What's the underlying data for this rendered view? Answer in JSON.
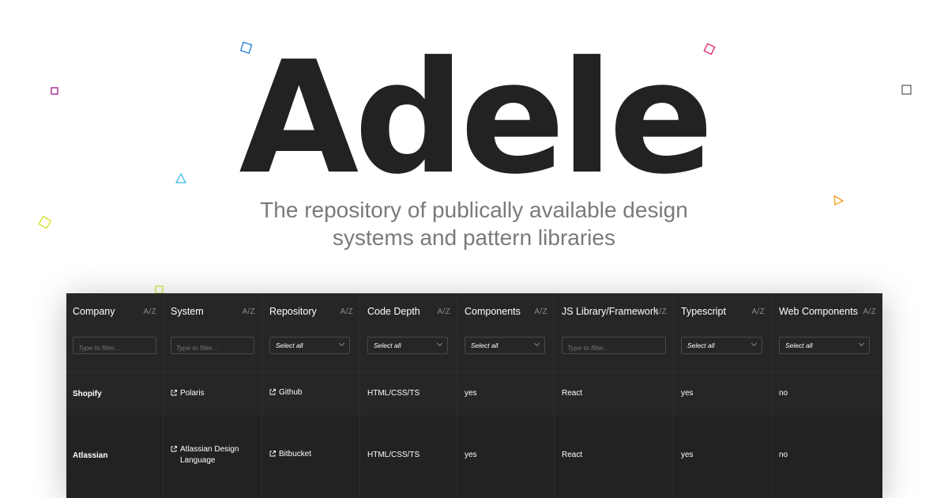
{
  "hero": {
    "title": "Adele",
    "subtitle": "The repository of publically available design systems and pattern libraries"
  },
  "colors": {
    "title": "#222222",
    "subtitle": "#7a7a7a",
    "table_bg": "#262626",
    "row_alt_bg": "#222222",
    "confetti_blue": "#1f7ad6",
    "confetti_pink": "#e0206e",
    "confetti_purple": "#a01a8c",
    "confetti_gray": "#555555",
    "confetti_cyan": "#2bb6e0",
    "confetti_yellow": "#d6e02b",
    "confetti_orange": "#f0a020"
  },
  "table": {
    "sort_label": "A/Z",
    "filter_placeholder": "Type to filter...",
    "select_placeholder": "Select all",
    "columns": [
      {
        "label": "Company",
        "filter": "input"
      },
      {
        "label": "System",
        "filter": "input"
      },
      {
        "label": "Repository",
        "filter": "select"
      },
      {
        "label": "Code Depth",
        "filter": "select"
      },
      {
        "label": "Components",
        "filter": "select"
      },
      {
        "label": "JS Library/Framework",
        "filter": "input"
      },
      {
        "label": "Typescript",
        "filter": "select"
      },
      {
        "label": "Web Components",
        "filter": "select"
      }
    ],
    "rows": [
      {
        "company": "Shopify",
        "system": "Polaris",
        "repository": "Github",
        "code_depth": "HTML/CSS/TS",
        "components": "yes",
        "js_framework": "React",
        "typescript": "yes",
        "web_components": "no"
      },
      {
        "company": "Atlassian",
        "system_line1": "Atlassian Design",
        "system_line2": "Language",
        "repository": "Bitbucket",
        "code_depth": "HTML/CSS/TS",
        "components": "yes",
        "js_framework": "React",
        "typescript": "yes",
        "web_components": "no"
      }
    ]
  }
}
